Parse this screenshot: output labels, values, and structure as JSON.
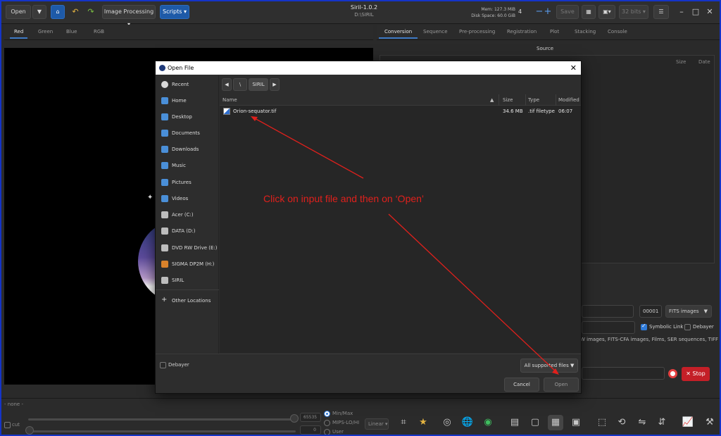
{
  "header": {
    "open_label": "Open",
    "image_processing_label": "Image Processing",
    "scripts_label": "Scripts",
    "title": "Siril-1.0.2",
    "subtitle": "D:\\SIRIL",
    "mem": "Mem: 127.3 MiB",
    "disk": "Disk Space: 60.0 GiB",
    "threads": "4",
    "save_label": "Save",
    "bits_label": "32 bits"
  },
  "left_tabs": [
    "Red",
    "Green",
    "Blue",
    "RGB"
  ],
  "right_tabs": [
    "Conversion",
    "Sequence",
    "Pre-processing",
    "Registration",
    "Plot",
    "Stacking",
    "Console"
  ],
  "conversion": {
    "source_label": "Source",
    "col_size": "Size",
    "col_date": "Date",
    "start_index": "00001",
    "output_format": "FITS images",
    "symbolic_link_label": "Symbolic Link",
    "debayer_label": "Debayer",
    "supported_text": "W images, FITS-CFA images, Films, SER sequences, TIFF",
    "stop_label": "Stop"
  },
  "bottom": {
    "none_label": "- none -",
    "cut_label": "cut",
    "hi_value": "65535",
    "lo_value": "0",
    "radio_options": [
      "Min/Max",
      "MIPS-LO/HI",
      "User"
    ],
    "scale_label": "Linear"
  },
  "dialog": {
    "title": "Open File",
    "close_glyph": "✕",
    "places": [
      {
        "label": "Recent",
        "color": "#d8d8d8"
      },
      {
        "label": "Home",
        "color": "#4a8fd8"
      },
      {
        "label": "Desktop",
        "color": "#4a8fd8"
      },
      {
        "label": "Documents",
        "color": "#4a8fd8"
      },
      {
        "label": "Downloads",
        "color": "#4a8fd8"
      },
      {
        "label": "Music",
        "color": "#4a8fd8"
      },
      {
        "label": "Pictures",
        "color": "#4a8fd8"
      },
      {
        "label": "Videos",
        "color": "#4a8fd8"
      },
      {
        "label": "Acer (C:)",
        "color": "#bdbdbd"
      },
      {
        "label": "DATA (D:)",
        "color": "#bdbdbd"
      },
      {
        "label": "DVD RW Drive (E:)",
        "color": "#bdbdbd"
      },
      {
        "label": "SIGMA DP2M (H:)",
        "color": "#d9822b"
      },
      {
        "label": "SIRIL",
        "color": "#bdbdbd"
      },
      {
        "label": "Other Locations",
        "color": "#d8d8d8"
      }
    ],
    "path": [
      "\\",
      "SIRIL"
    ],
    "columns": {
      "name": "Name",
      "size": "Size",
      "type": "Type",
      "modified": "Modified"
    },
    "files": [
      {
        "name": "Orion-sequator.tif",
        "size": "34.6 MB",
        "type": ".tif filetype",
        "modified": "06:07"
      }
    ],
    "debayer_label": "Debayer",
    "filter_label": "All supported files",
    "cancel_label": "Cancel",
    "open_label": "Open"
  },
  "annotation": {
    "text": "Click on input file and then on ‘Open’",
    "color": "#e0201c"
  }
}
